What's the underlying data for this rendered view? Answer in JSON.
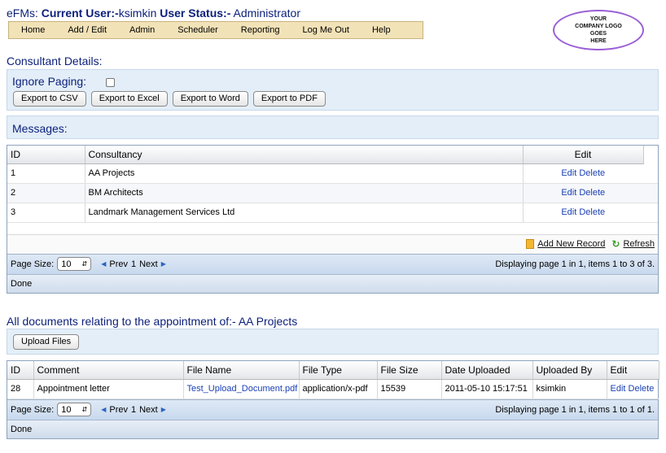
{
  "header": {
    "app_name": "eFMs:",
    "current_user_label": "Current User:-",
    "current_user": "ksimkin",
    "status_label": "User Status:-",
    "status": "Administrator"
  },
  "menu": [
    {
      "label": "Home"
    },
    {
      "label": "Add / Edit"
    },
    {
      "label": "Admin"
    },
    {
      "label": "Scheduler"
    },
    {
      "label": "Reporting"
    },
    {
      "label": "Log Me Out"
    },
    {
      "label": "Help"
    }
  ],
  "logo": {
    "text_1": "YOUR",
    "text_2": "COMPANY LOGO",
    "text_3": "GOES",
    "text_4": "HERE"
  },
  "consultant": {
    "title": "Consultant Details:",
    "ignore_paging_label": "Ignore Paging:",
    "export_buttons": [
      "Export to CSV",
      "Export to Excel",
      "Export to Word",
      "Export to PDF"
    ],
    "messages_label": "Messages:"
  },
  "grid1": {
    "headers": {
      "id": "ID",
      "consultancy": "Consultancy",
      "edit": "Edit"
    },
    "rows": [
      {
        "id": "1",
        "consultancy": "AA Projects",
        "edit": "Edit",
        "delete": "Delete"
      },
      {
        "id": "2",
        "consultancy": "BM Architects",
        "edit": "Edit",
        "delete": "Delete"
      },
      {
        "id": "3",
        "consultancy": "Landmark Management Services Ltd",
        "edit": "Edit",
        "delete": "Delete"
      }
    ],
    "add_new_record": "Add New Record",
    "refresh": "Refresh",
    "page_size_label": "Page Size:",
    "page_size": "10",
    "prev": "Prev",
    "page": "1",
    "next": "Next",
    "display_info": "Displaying page 1 in 1, items 1 to 3 of 3.",
    "status": "Done"
  },
  "documents": {
    "title": "All documents relating to the appointment of:- AA Projects",
    "upload_button": "Upload Files",
    "headers": {
      "id": "ID",
      "comment": "Comment",
      "file_name": "File Name",
      "file_type": "File Type",
      "file_size": "File Size",
      "date_uploaded": "Date Uploaded",
      "uploaded_by": "Uploaded By",
      "edit": "Edit"
    },
    "rows": [
      {
        "id": "28",
        "comment": "Appointment letter",
        "file_name": "Test_Upload_Document.pdf",
        "file_type": "application/x-pdf",
        "file_size": "15539",
        "date_uploaded": "2011-05-10 15:17:51",
        "uploaded_by": "ksimkin",
        "edit": "Edit",
        "delete": "Delete"
      }
    ],
    "page_size_label": "Page Size:",
    "page_size": "10",
    "prev": "Prev",
    "page": "1",
    "next": "Next",
    "display_info": "Displaying page 1 in 1, items 1 to 1 of 1.",
    "status": "Done"
  },
  "colors": {
    "title_blue": "#0b1f7a",
    "link_blue": "#1a3fb4",
    "menu_bg": "#f2e2b7",
    "panel_bg": "#e3eef8",
    "logo_border": "#9a5fd6"
  }
}
